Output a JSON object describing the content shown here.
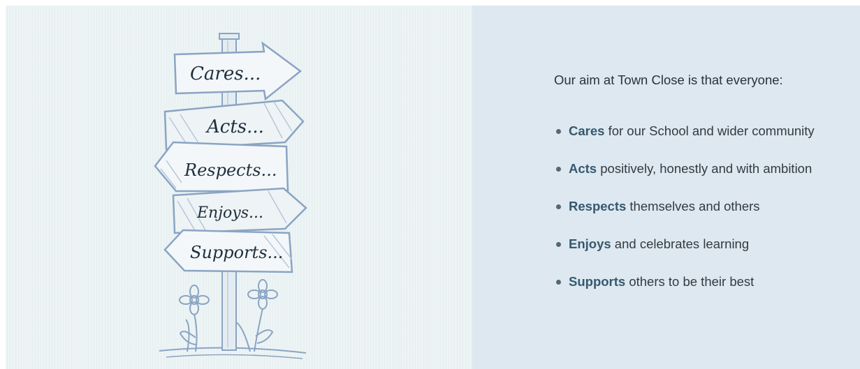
{
  "illustration": {
    "signs": [
      "Cares...",
      "Acts...",
      "Respects...",
      "Enjoys...",
      "Supports..."
    ],
    "ink_color": "#8aa4c3",
    "text_color": "#1f2f3d"
  },
  "aim": {
    "intro": "Our aim at Town Close is that everyone:",
    "items": [
      {
        "word": "Cares",
        "rest": " for our School and wider community"
      },
      {
        "word": "Acts",
        "rest": " positively, honestly and with ambition"
      },
      {
        "word": "Respects",
        "rest": " themselves and others"
      },
      {
        "word": "Enjoys",
        "rest": " and celebrates learning"
      },
      {
        "word": "Supports",
        "rest": " others to be their best"
      }
    ]
  },
  "colors": {
    "left_bg": "#e9f1f2",
    "right_bg": "#dde8f0",
    "accent": "#37586f",
    "bullet": "#536877"
  }
}
